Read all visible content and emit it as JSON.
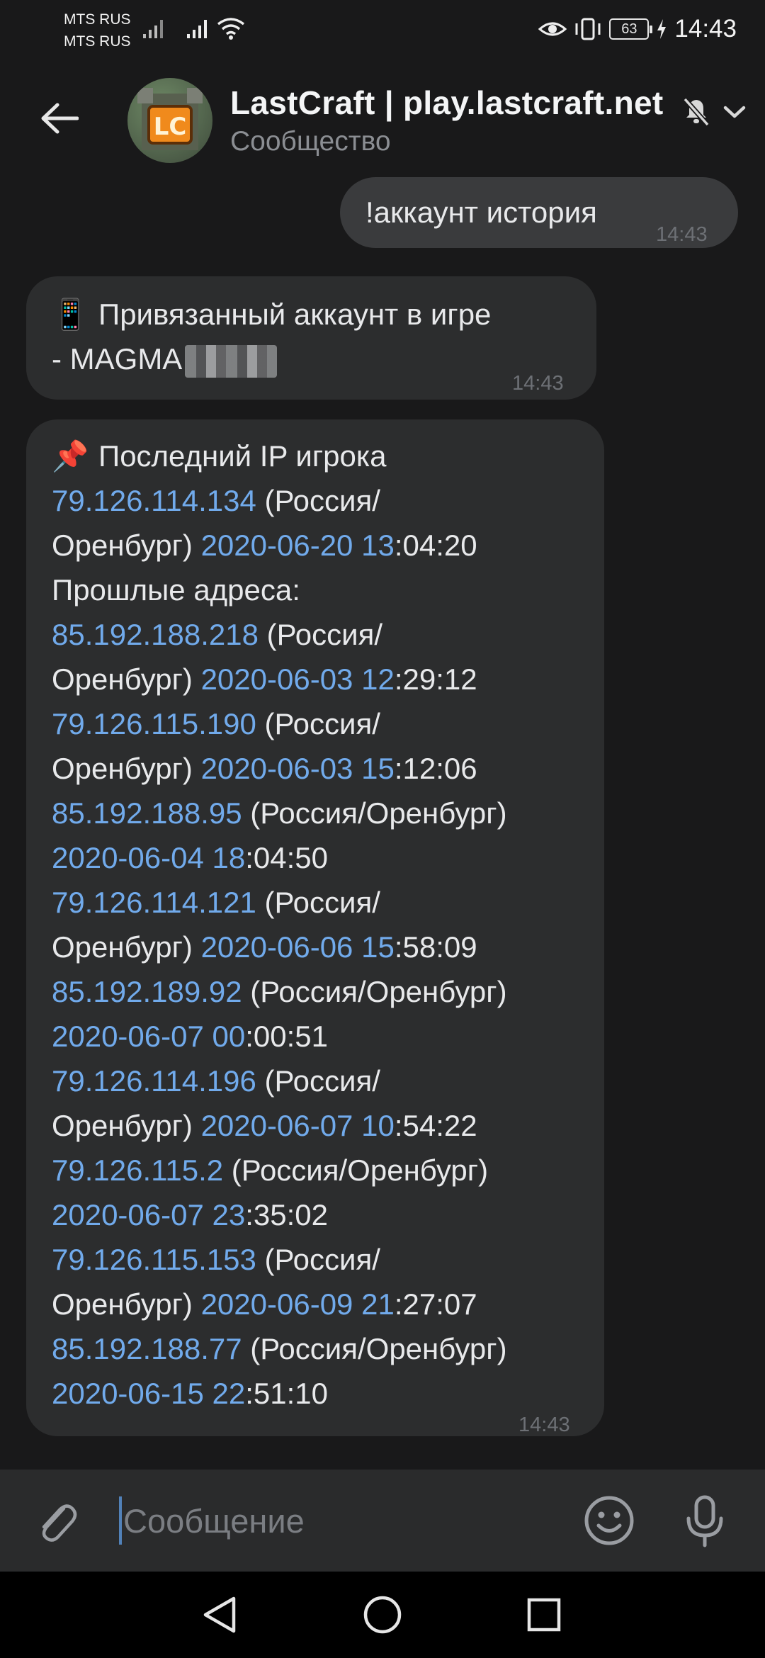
{
  "status_bar": {
    "carrier_1": "MTS RUS",
    "carrier_2": "MTS RUS",
    "battery": "63",
    "time": "14:43"
  },
  "header": {
    "title": "LastCraft | play.lastcraft.net",
    "subtitle": "Сообщество",
    "avatar_text": "LC"
  },
  "messages": {
    "outgoing": {
      "text": "!аккаунт история",
      "time": "14:43"
    },
    "linked": {
      "emoji": "📱",
      "line1": "Привязанный аккаунт в игре",
      "line2": "- MAGMA",
      "time": "14:43"
    },
    "ip_history": {
      "emoji": "📌",
      "heading": "Последний IP игрока",
      "past_label": "Прошлые адреса:",
      "time": "14:43",
      "lines": [
        {
          "ip": "79.126.114.134",
          "rest": " (Россия/"
        },
        {
          "rest": "Оренбург) ",
          "date": "2020-06-20 13",
          "tail": ":04:20"
        },
        {
          "rest": "Прошлые адреса:"
        },
        {
          "ip": "85.192.188.218",
          "rest": " (Россия/"
        },
        {
          "rest": "Оренбург) ",
          "date": "2020-06-03 12",
          "tail": ":29:12"
        },
        {
          "ip": "79.126.115.190",
          "rest": " (Россия/"
        },
        {
          "rest": "Оренбург) ",
          "date": "2020-06-03 15",
          "tail": ":12:06"
        },
        {
          "ip": "85.192.188.95",
          "rest": " (Россия/Оренбург)"
        },
        {
          "date": "2020-06-04 18",
          "tail": ":04:50"
        },
        {
          "ip": "79.126.114.121",
          "rest": " (Россия/"
        },
        {
          "rest": "Оренбург) ",
          "date": "2020-06-06 15",
          "tail": ":58:09"
        },
        {
          "ip": "85.192.189.92",
          "rest": " (Россия/Оренбург)"
        },
        {
          "date": "2020-06-07 00",
          "tail": ":00:51"
        },
        {
          "ip": "79.126.114.196",
          "rest": " (Россия/"
        },
        {
          "rest": "Оренбург) ",
          "date": "2020-06-07 10",
          "tail": ":54:22"
        },
        {
          "ip": "79.126.115.2",
          "rest": " (Россия/Оренбург)"
        },
        {
          "date": "2020-06-07 23",
          "tail": ":35:02"
        },
        {
          "ip": "79.126.115.153",
          "rest": " (Россия/"
        },
        {
          "rest": "Оренбург) ",
          "date": "2020-06-09 21",
          "tail": ":27:07"
        },
        {
          "ip": "85.192.188.77",
          "rest": " (Россия/Оренбург)"
        },
        {
          "date": "2020-06-15 22",
          "tail": ":51:10"
        }
      ]
    }
  },
  "composer": {
    "placeholder": "Сообщение"
  },
  "icons": {
    "back": "arrow-left-icon",
    "mute": "muted-bell-icon",
    "attach": "paperclip-icon",
    "emoji": "smile-icon",
    "mic": "microphone-icon"
  },
  "colors": {
    "background": "#19191a",
    "bubble": "#2c2d2e",
    "link": "#71aaeb",
    "accent": "#5181b8"
  }
}
